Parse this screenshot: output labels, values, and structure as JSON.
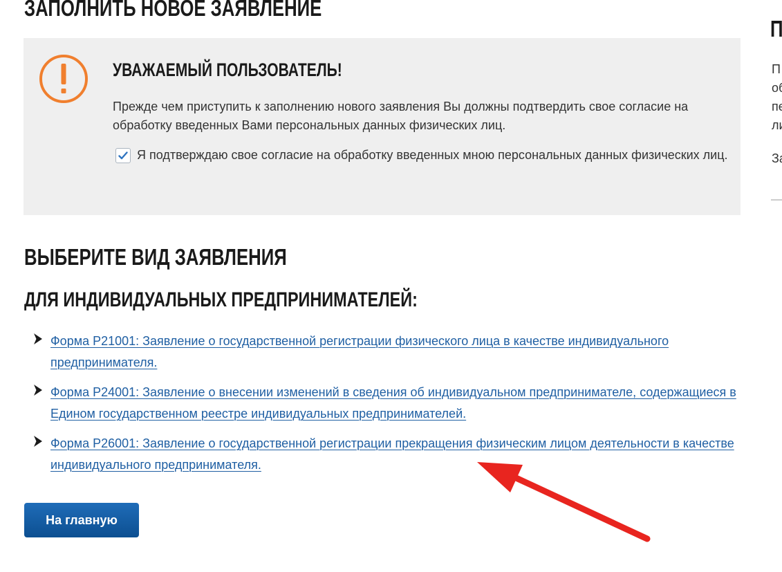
{
  "page": {
    "top_title": "Заполнить новое заявление"
  },
  "notice": {
    "title": "Уважаемый пользователь!",
    "text": "Прежде чем приступить к заполнению нового заявления Вы должны подтвердить свое согласие на обработку введенных Вами персональных данных физических лиц.",
    "consent_label": "Я подтверждаю свое согласие на обработку введенных мною персональных данных физических лиц.",
    "consent_checked": true,
    "icon": "exclamation-circle-icon",
    "accent_color": "#f07f2e"
  },
  "choose": {
    "title": "Выберите вид заявления",
    "subtitle": "Для индивидуальных предпринимателей:",
    "forms": [
      {
        "label": "Форма Р21001: Заявление о государственной регистрации физического лица в качестве индивидуального предпринимателя."
      },
      {
        "label": "Форма Р24001: Заявление о внесении изменений в сведения об индивидуальном предпринимателе, содержащиеся в Едином государственном реестре индивидуальных предпринимателей."
      },
      {
        "label": "Форма Р26001: Заявление о государственной регистрации прекращения физическим лицом деятельности в качестве индивидуального предпринимателя."
      }
    ]
  },
  "actions": {
    "home_label": "На главную"
  },
  "sidebar": {
    "title": "П",
    "lines": [
      "П",
      "об",
      "пе",
      "ли"
    ],
    "last_line": "За"
  },
  "colors": {
    "link": "#1f5fa3",
    "button": "#0c4f91",
    "annotation_arrow": "#e8251f"
  }
}
